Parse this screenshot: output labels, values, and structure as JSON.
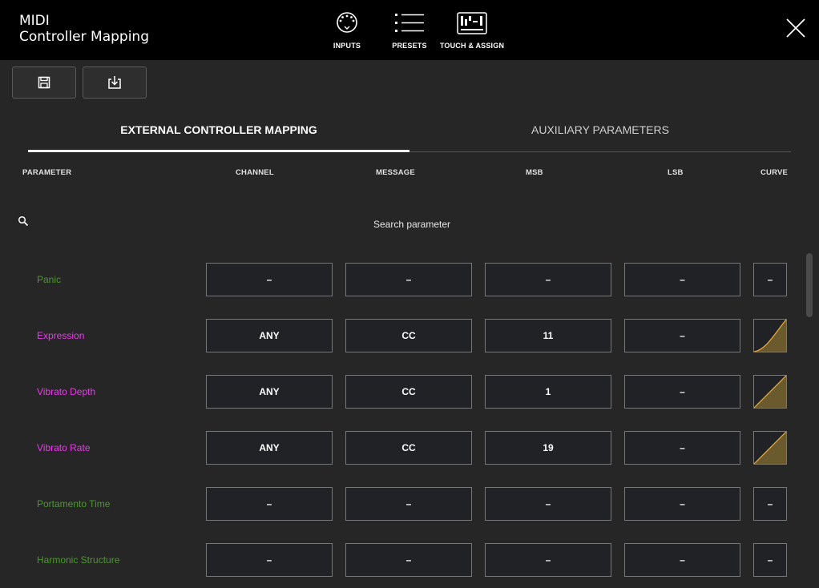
{
  "app": {
    "title_line1": "MIDI",
    "title_line2": "Controller Mapping"
  },
  "nav": [
    {
      "label": "INPUTS",
      "icon": "midi-din-icon"
    },
    {
      "label": "PRESETS",
      "icon": "list-icon"
    },
    {
      "label": "TOUCH & ASSIGN",
      "icon": "controller-icon"
    }
  ],
  "toolbar": {
    "save_icon": "save-icon",
    "import_icon": "import-icon"
  },
  "tabs": [
    {
      "label": "EXTERNAL CONTROLLER MAPPING",
      "active": true
    },
    {
      "label": "AUXILIARY PARAMETERS",
      "active": false
    }
  ],
  "columns": {
    "parameter": "PARAMETER",
    "channel": "CHANNEL",
    "message": "MESSAGE",
    "msb": "MSB",
    "lsb": "LSB",
    "curve": "CURVE"
  },
  "search": {
    "placeholder": "Search parameter"
  },
  "colors": {
    "assigned": "#e83be8",
    "unassigned": "#4a9a2a",
    "curve_fill": "#6b5a2e",
    "curve_line": "#e8a83a"
  },
  "rows": [
    {
      "name": "Panic",
      "assigned": false,
      "channel": "–",
      "message": "–",
      "msb": "–",
      "lsb": "–",
      "curve": "–"
    },
    {
      "name": "Expression",
      "assigned": true,
      "channel": "ANY",
      "message": "CC",
      "msb": "11",
      "lsb": "–",
      "curve": "exponential"
    },
    {
      "name": "Vibrato Depth",
      "assigned": true,
      "channel": "ANY",
      "message": "CC",
      "msb": "1",
      "lsb": "–",
      "curve": "linear"
    },
    {
      "name": "Vibrato Rate",
      "assigned": true,
      "channel": "ANY",
      "message": "CC",
      "msb": "19",
      "lsb": "–",
      "curve": "linear"
    },
    {
      "name": "Portamento Time",
      "assigned": false,
      "channel": "–",
      "message": "–",
      "msb": "–",
      "lsb": "–",
      "curve": "–"
    },
    {
      "name": "Harmonic Structure",
      "assigned": false,
      "channel": "–",
      "message": "–",
      "msb": "–",
      "lsb": "–",
      "curve": "–"
    }
  ]
}
